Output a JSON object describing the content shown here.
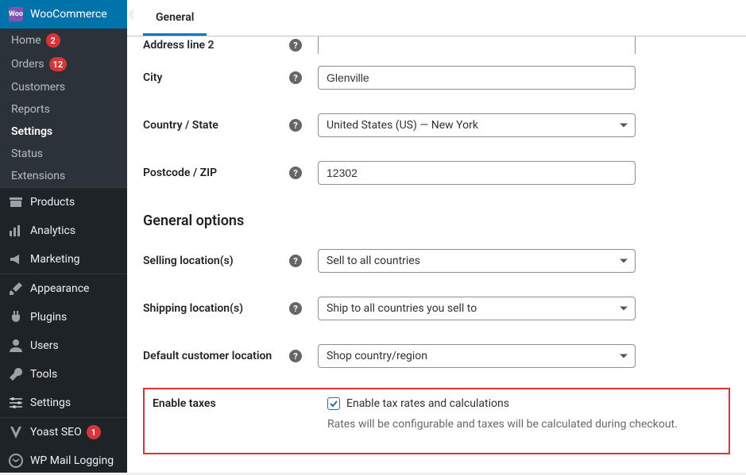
{
  "sidebar": {
    "current": {
      "label": "WooCommerce",
      "icon": "woo"
    },
    "submenu": [
      {
        "label": "Home",
        "badge": "2"
      },
      {
        "label": "Orders",
        "badge": "12"
      },
      {
        "label": "Customers"
      },
      {
        "label": "Reports"
      },
      {
        "label": "Settings",
        "active": true
      },
      {
        "label": "Status"
      },
      {
        "label": "Extensions"
      }
    ],
    "items": [
      {
        "label": "Products",
        "icon": "products"
      },
      {
        "label": "Analytics",
        "icon": "analytics"
      },
      {
        "label": "Marketing",
        "icon": "marketing"
      },
      {
        "sep": true
      },
      {
        "label": "Appearance",
        "icon": "appearance"
      },
      {
        "label": "Plugins",
        "icon": "plugins"
      },
      {
        "label": "Users",
        "icon": "users"
      },
      {
        "label": "Tools",
        "icon": "tools"
      },
      {
        "label": "Settings",
        "icon": "settings"
      },
      {
        "sep": true
      },
      {
        "label": "Yoast SEO",
        "icon": "yoast",
        "badge": "1"
      },
      {
        "label": "WP Mail Logging",
        "icon": "mail"
      }
    ]
  },
  "tab": {
    "label": "General"
  },
  "form": {
    "address2": {
      "label": "Address line 2",
      "value": ""
    },
    "city": {
      "label": "City",
      "value": "Glenville"
    },
    "country": {
      "label": "Country / State",
      "value": "United States (US) — New York"
    },
    "postcode": {
      "label": "Postcode / ZIP",
      "value": "12302"
    }
  },
  "general_heading": "General options",
  "general": {
    "selling": {
      "label": "Selling location(s)",
      "value": "Sell to all countries"
    },
    "shipping": {
      "label": "Shipping location(s)",
      "value": "Ship to all countries you sell to"
    },
    "default_loc": {
      "label": "Default customer location",
      "value": "Shop country/region"
    }
  },
  "taxes": {
    "label": "Enable taxes",
    "checkbox_label": "Enable tax rates and calculations",
    "description": "Rates will be configurable and taxes will be calculated during checkout."
  }
}
